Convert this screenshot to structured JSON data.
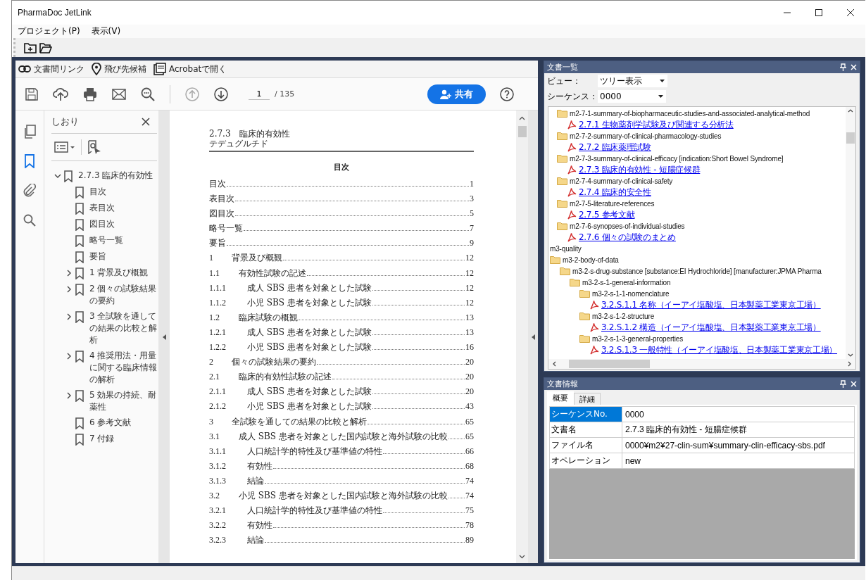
{
  "window": {
    "title": "PharmaDoc JetLink"
  },
  "menu": [
    {
      "label": "プロジェクト(P)"
    },
    {
      "label": "表示(V)"
    }
  ],
  "viewer": {
    "actions": [
      {
        "kind": "link",
        "label": "文書間リンク"
      },
      {
        "kind": "pin",
        "label": "飛び先候補"
      },
      {
        "kind": "acrobat",
        "label": "Acrobatで開く"
      }
    ],
    "page_field": {
      "value": "1"
    },
    "page_total": "/ 135",
    "share_button": "共有",
    "side_rail": [
      {
        "kind": "pages",
        "selected": false
      },
      {
        "kind": "bookmarks",
        "selected": true
      },
      {
        "kind": "attachments",
        "selected": false
      },
      {
        "kind": "search",
        "selected": false
      }
    ],
    "bookmarks_panel": {
      "title": "しおり",
      "items": [
        {
          "label": "2.7.3 臨床的有効性",
          "expanded": true,
          "children": [
            {
              "label": "目次"
            },
            {
              "label": "表目次"
            },
            {
              "label": "図目次"
            },
            {
              "label": "略号一覧"
            },
            {
              "label": "要旨"
            },
            {
              "label": "1  背景及び概観",
              "expanded": false
            },
            {
              "label": "2  個々の試験結果の要約",
              "expanded": false
            },
            {
              "label": "3  全試験を通しての結果の比較と解析",
              "expanded": false
            },
            {
              "label": "4  推奨用法・用量に関する臨床情報の解析",
              "expanded": false
            },
            {
              "label": "5  効果の持続、耐薬性",
              "expanded": false
            },
            {
              "label": "6  参考文献"
            },
            {
              "label": "7  付録"
            }
          ]
        }
      ]
    },
    "document": {
      "header_lines": [
        "2.7.3　臨床的有効性",
        "テデュグルチド"
      ],
      "heading": "目次",
      "toc": [
        {
          "title": "目次",
          "page": "1"
        },
        {
          "title": "表目次",
          "page": "3"
        },
        {
          "title": "図目次",
          "page": "5"
        },
        {
          "title": "略号一覧",
          "page": "7"
        },
        {
          "title": "要旨",
          "page": "9"
        },
        {
          "number": "1",
          "title": "背景及び概観",
          "page": "12",
          "children": [
            {
              "number": "1.1",
              "title": "有効性試験の記述",
              "page": "12",
              "children": [
                {
                  "number": "1.1.1",
                  "title": "成人 SBS 患者を対象とした試験",
                  "page": "12"
                },
                {
                  "number": "1.1.2",
                  "title": "小児 SBS 患者を対象とした試験",
                  "page": "12"
                }
              ]
            },
            {
              "number": "1.2",
              "title": "臨床試験の概観",
              "page": "13",
              "children": [
                {
                  "number": "1.2.1",
                  "title": "成人 SBS 患者を対象とした試験",
                  "page": "13"
                },
                {
                  "number": "1.2.2",
                  "title": "小児 SBS 患者を対象とした試験",
                  "page": "16"
                }
              ]
            }
          ]
        },
        {
          "number": "2",
          "title": "個々の試験結果の要約",
          "page": "20",
          "children": [
            {
              "number": "2.1",
              "title": "臨床的有効性試験の記述",
              "page": "20",
              "children": [
                {
                  "number": "2.1.1",
                  "title": "成人 SBS 患者を対象とした試験",
                  "page": "20"
                },
                {
                  "number": "2.1.2",
                  "title": "小児 SBS 患者を対象とした試験",
                  "page": "43"
                }
              ]
            }
          ]
        },
        {
          "number": "3",
          "title": "全試験を通しての結果の比較と解析",
          "page": "65",
          "children": [
            {
              "number": "3.1",
              "title": "成人 SBS 患者を対象とした国内試験と海外試験の比較",
              "page": "65",
              "children": [
                {
                  "number": "3.1.1",
                  "title": "人口統計学的特性及び基準値の特性",
                  "page": "66"
                },
                {
                  "number": "3.1.2",
                  "title": "有効性",
                  "page": "68"
                },
                {
                  "number": "3.1.3",
                  "title": "結論",
                  "page": "74"
                }
              ]
            },
            {
              "number": "3.2",
              "title": "小児 SBS 患者を対象とした国内試験と海外試験の比較",
              "page": "74",
              "children": [
                {
                  "number": "3.2.1",
                  "title": "人口統計学的特性及び基準値の特性",
                  "page": "75"
                },
                {
                  "number": "3.2.2",
                  "title": "有効性",
                  "page": "78"
                },
                {
                  "number": "3.2.3",
                  "title": "結論",
                  "page": "89"
                }
              ]
            }
          ]
        }
      ]
    }
  },
  "document_list": {
    "title": "文書一覧",
    "view": {
      "label": "ビュー：",
      "value": "ツリー表示"
    },
    "sequence": {
      "label": "シーケンス：",
      "value": "0000"
    },
    "tree": [
      {
        "kind": "folder",
        "label": "m2-7-1-summary-of-biopharmaceutic-studies-and-associated-analytical-method",
        "children": [
          {
            "kind": "pdf",
            "label": "2.7.1 生物薬剤学試験及び関連する分析法"
          }
        ]
      },
      {
        "kind": "folder",
        "label": "m2-7-2-summary-of-clinical-pharmacology-studies",
        "children": [
          {
            "kind": "pdf",
            "label": "2.7.2 臨床薬理試験"
          }
        ]
      },
      {
        "kind": "folder",
        "label": "m2-7-3-summary-of-clinical-efficacy [indication:Short Bowel Syndrome]",
        "children": [
          {
            "kind": "pdf",
            "label": "2.7.3 臨床的有効性 - 短腸症候群"
          }
        ]
      },
      {
        "kind": "folder",
        "label": "m2-7-4-summary-of-clinical-safety",
        "children": [
          {
            "kind": "pdf",
            "label": "2.7.4 臨床的安全性"
          }
        ]
      },
      {
        "kind": "folder",
        "label": "m2-7-5-literature-references",
        "children": [
          {
            "kind": "pdf",
            "label": "2.7.5 参考文献"
          }
        ]
      },
      {
        "kind": "folder",
        "label": "m2-7-6-synopses-of-individual-studies",
        "children": [
          {
            "kind": "pdf",
            "label": "2.7.6 個々の試験のまとめ"
          }
        ]
      },
      {
        "kind": "label",
        "label": "m3-quality"
      },
      {
        "kind": "folder",
        "label": "m3-2-body-of-data",
        "children": [
          {
            "kind": "folder",
            "label": "m3-2-s-drug-substance [substance:EI Hydrochloride] [manufacturer:JPMA Pharma",
            "children": [
              {
                "kind": "folder",
                "label": "m3-2-s-1-general-information",
                "children": [
                  {
                    "kind": "folder",
                    "label": "m3-2-s-1-1-nomenclature",
                    "children": [
                      {
                        "kind": "pdf",
                        "label": "3.2.S.1.1 名称（イーアイ塩酸塩、日本製薬工業東京工場）"
                      }
                    ]
                  },
                  {
                    "kind": "folder",
                    "label": "m3-2-s-1-2-structure",
                    "children": [
                      {
                        "kind": "pdf",
                        "label": "3.2.S.1.2 構造（イーアイ塩酸塩、日本製薬工業東京工場）"
                      }
                    ]
                  },
                  {
                    "kind": "folder",
                    "label": "m3-2-s-1-3-general-properties",
                    "children": [
                      {
                        "kind": "pdf",
                        "label": "3.2.S.1.3 一般特性（イーアイ塩酸塩、日本製薬工業東京工場）"
                      }
                    ]
                  }
                ]
              }
            ]
          }
        ]
      }
    ]
  },
  "document_info": {
    "title": "文書情報",
    "tabs": [
      {
        "label": "概要",
        "selected": true
      },
      {
        "label": "詳細",
        "selected": false
      }
    ],
    "rows": [
      {
        "label": "シーケンスNo.",
        "value": "0000",
        "selected": true
      },
      {
        "label": "文書名",
        "value": "2.7.3 臨床的有効性 - 短腸症候群",
        "selected": false
      },
      {
        "label": "ファイル名",
        "value": "0000¥m2¥27-clin-sum¥summary-clin-efficacy-sbs.pdf",
        "selected": false
      },
      {
        "label": "オペレーション",
        "value": "new",
        "selected": false
      }
    ]
  }
}
